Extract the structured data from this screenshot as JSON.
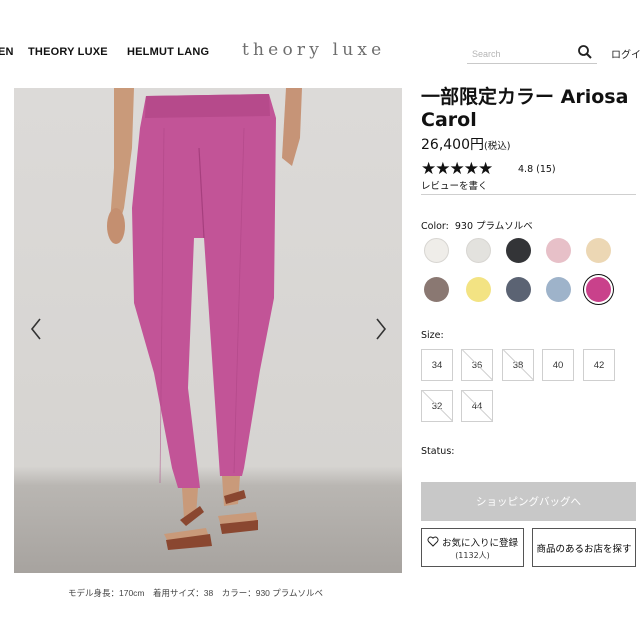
{
  "header": {
    "brands": [
      "EN",
      "THEORY LUXE",
      "HELMUT LANG"
    ],
    "logo": "theory luxe",
    "search": {
      "placeholder": "Search",
      "value": ""
    },
    "login": "ログイン"
  },
  "gallery": {
    "caption": "モデル身長：170cm　着用サイズ：38　カラー：930 プラムソルベ",
    "prev_icon": "chevron-left-icon",
    "next_icon": "chevron-right-icon"
  },
  "product": {
    "title": "一部限定カラー Ariosa Carol",
    "price": "26,400円",
    "price_tax": "(税込)",
    "rating_stars": 5,
    "rating": "4.8 (15)",
    "review_link": "レビューを書く",
    "color_label": "Color:",
    "color_value": "930 プラムソルベ",
    "colors": [
      "#efede9",
      "#e3e2de",
      "#333437",
      "#e7c0c8",
      "#ecd7b4",
      "#8a7872",
      "#f3e383",
      "#5b6373",
      "#9eb3ca",
      "#c9418b"
    ],
    "selected_color_index": 9,
    "size_label": "Size:",
    "sizes": [
      {
        "label": "34",
        "available": true
      },
      {
        "label": "36",
        "available": false
      },
      {
        "label": "38",
        "available": false
      },
      {
        "label": "40",
        "available": true
      },
      {
        "label": "42",
        "available": true
      },
      {
        "label": "32",
        "available": false
      },
      {
        "label": "44",
        "available": false
      }
    ],
    "status_label": "Status:",
    "bag_button": "ショッピングバッグへ",
    "favorite_button": "お気に入りに登録",
    "favorite_count": "(1132人)",
    "store_button": "商品のあるお店を探す"
  }
}
